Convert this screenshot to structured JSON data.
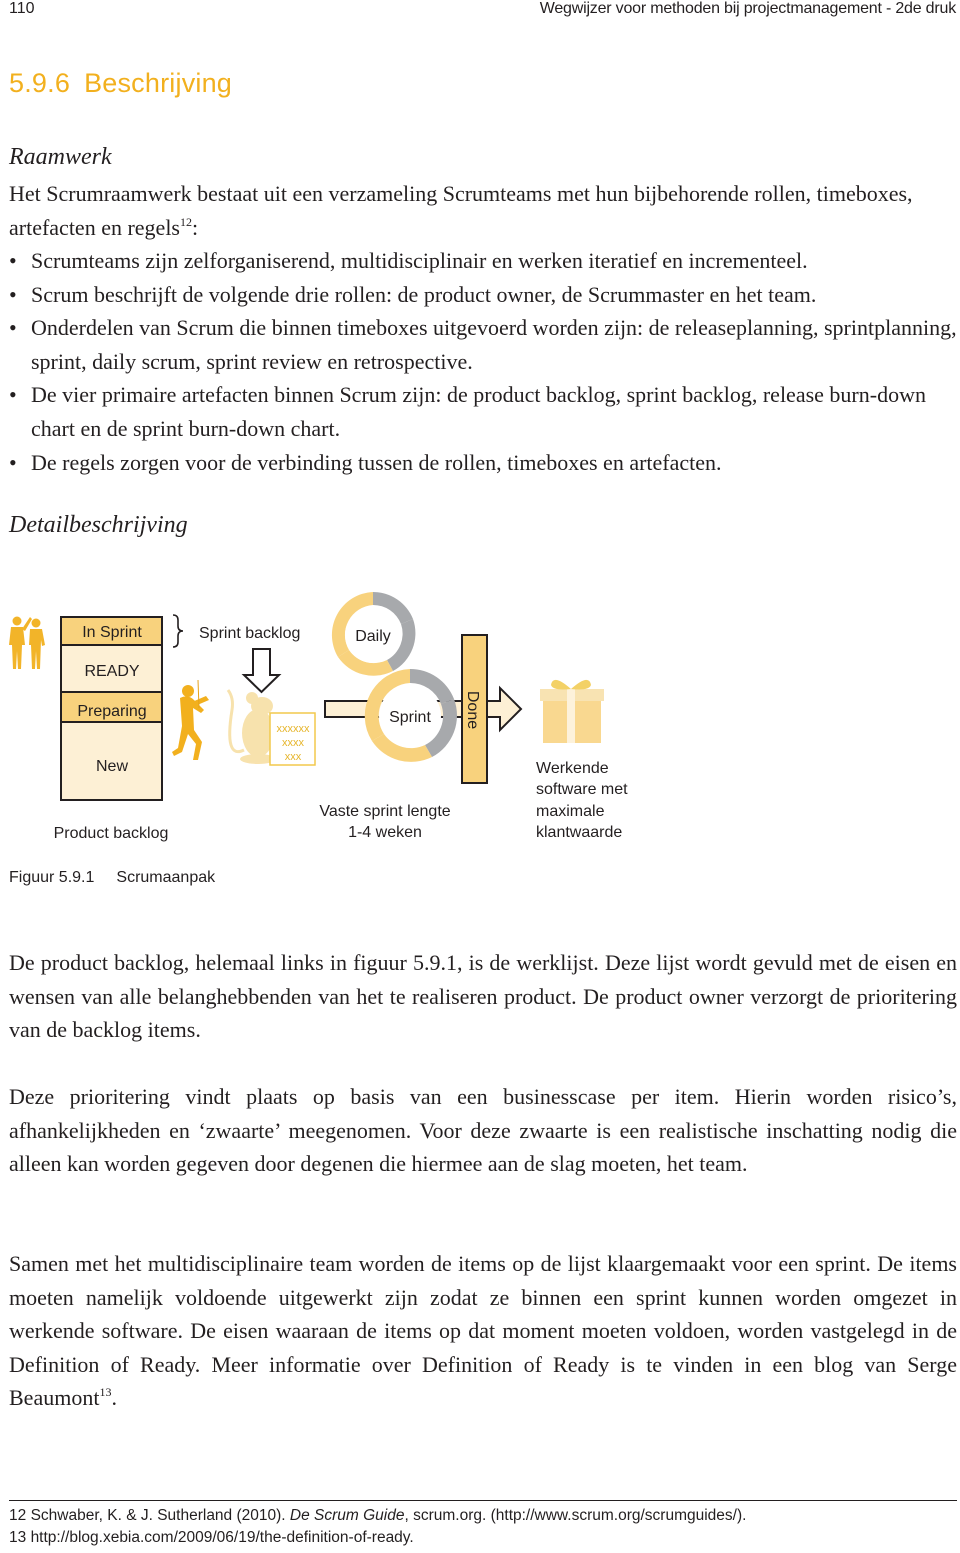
{
  "header": {
    "page_number": "110",
    "running_head": "Wegwijzer voor methoden bij projectmanagement - 2de druk"
  },
  "section": {
    "number": "5.9.6",
    "title": "Beschrijving",
    "accent_color": "#f2b01e"
  },
  "raamwerk": {
    "heading": "Raamwerk",
    "intro_text": "Het Scrumraamwerk bestaat uit een verzameling Scrumteams met hun bijbehorende rollen, timeboxes, artefacten en regels",
    "intro_footnote_ref": "12",
    "intro_suffix": ":",
    "bullets": [
      "Scrumteams zijn zelforganiserend, multidisciplinair en werken iteratief en incrementeel.",
      "Scrum beschrijft de volgende drie rollen: de product owner, de Scrummaster en het team.",
      "Onderdelen van Scrum die binnen timeboxes uitgevoerd worden zijn: de releaseplanning, sprintplanning, sprint, daily scrum, sprint review en retrospective.",
      "De vier primaire artefacten binnen Scrum zijn: de product backlog, sprint backlog, release burn-down chart en de sprint burn-down chart.",
      "De regels zorgen voor de verbinding tussen de rollen, timeboxes en artefacten."
    ]
  },
  "detail": {
    "heading": "Detailbeschrijving"
  },
  "figure": {
    "backlog_rows": [
      "In Sprint",
      "READY",
      "Preparing",
      "New"
    ],
    "product_backlog_label": "Product backlog",
    "sprint_backlog_label": "Sprint backlog",
    "task_card_lines": [
      "xxxxxx",
      "xxxx",
      "xxx"
    ],
    "daily_label": "Daily",
    "sprint_label": "Sprint",
    "done_label": "Done",
    "sprint_length_lines": [
      "Vaste sprint lengte",
      "1-4 weken"
    ],
    "result_lines": [
      "Werkende",
      "software met",
      "maximale",
      "klantwaarde"
    ],
    "icons": [
      "team-silhouette-icon",
      "violinist-icon",
      "rat-icon",
      "gift-box-icon",
      "down-arrow-icon",
      "right-arrow-icon",
      "cycle-icon"
    ],
    "colors": {
      "dark_yellow": "#f8d27d",
      "light_yellow": "#fdf0d5",
      "gold": "#f2b01e",
      "gray": "#a7a9ac",
      "pale_gold": "#f7dfa5"
    },
    "caption_label": "Figuur 5.9.1",
    "caption_title": "Scrumaanpak"
  },
  "paragraphs": {
    "p1": "De product backlog, helemaal links in figuur 5.9.1, is de werklijst. Deze lijst wordt gevuld met de eisen en wensen van alle belanghebbenden van het te realiseren product. De product owner verzorgt de prioritering van de backlog items.",
    "p2": "Deze prioritering vindt plaats op basis van een businesscase per item. Hierin worden risico’s, afhankelijkheden en ‘zwaarte’ meegenomen. Voor deze zwaarte is een realistische inschatting nodig die alleen kan worden gegeven door degenen die hiermee aan de slag moeten, het team.",
    "p3": "Samen met het multidisciplinaire team worden de items op de lijst klaargemaakt voor een sprint. De items moeten namelijk voldoende uitgewerkt zijn zodat ze binnen een sprint kunnen worden omgezet in werkende software. De eisen waaraan de items op dat moment moeten voldoen, worden vastgelegd in de Definition of Ready. Meer informatie over Definition of Ready is te vinden in een blog van Serge Beaumont",
    "p3_footnote_ref": "13",
    "p3_suffix": "."
  },
  "footnotes": {
    "fn12_number": "12",
    "fn12_before": "Schwaber, K. & J. Sutherland (2010). ",
    "fn12_title": "De Scrum Guide",
    "fn12_after": ", scrum.org. (http://www.scrum.org/scrumguides/).",
    "fn13_number": "13",
    "fn13_text": "http://blog.xebia.com/2009/06/19/the-definition-of-ready."
  }
}
